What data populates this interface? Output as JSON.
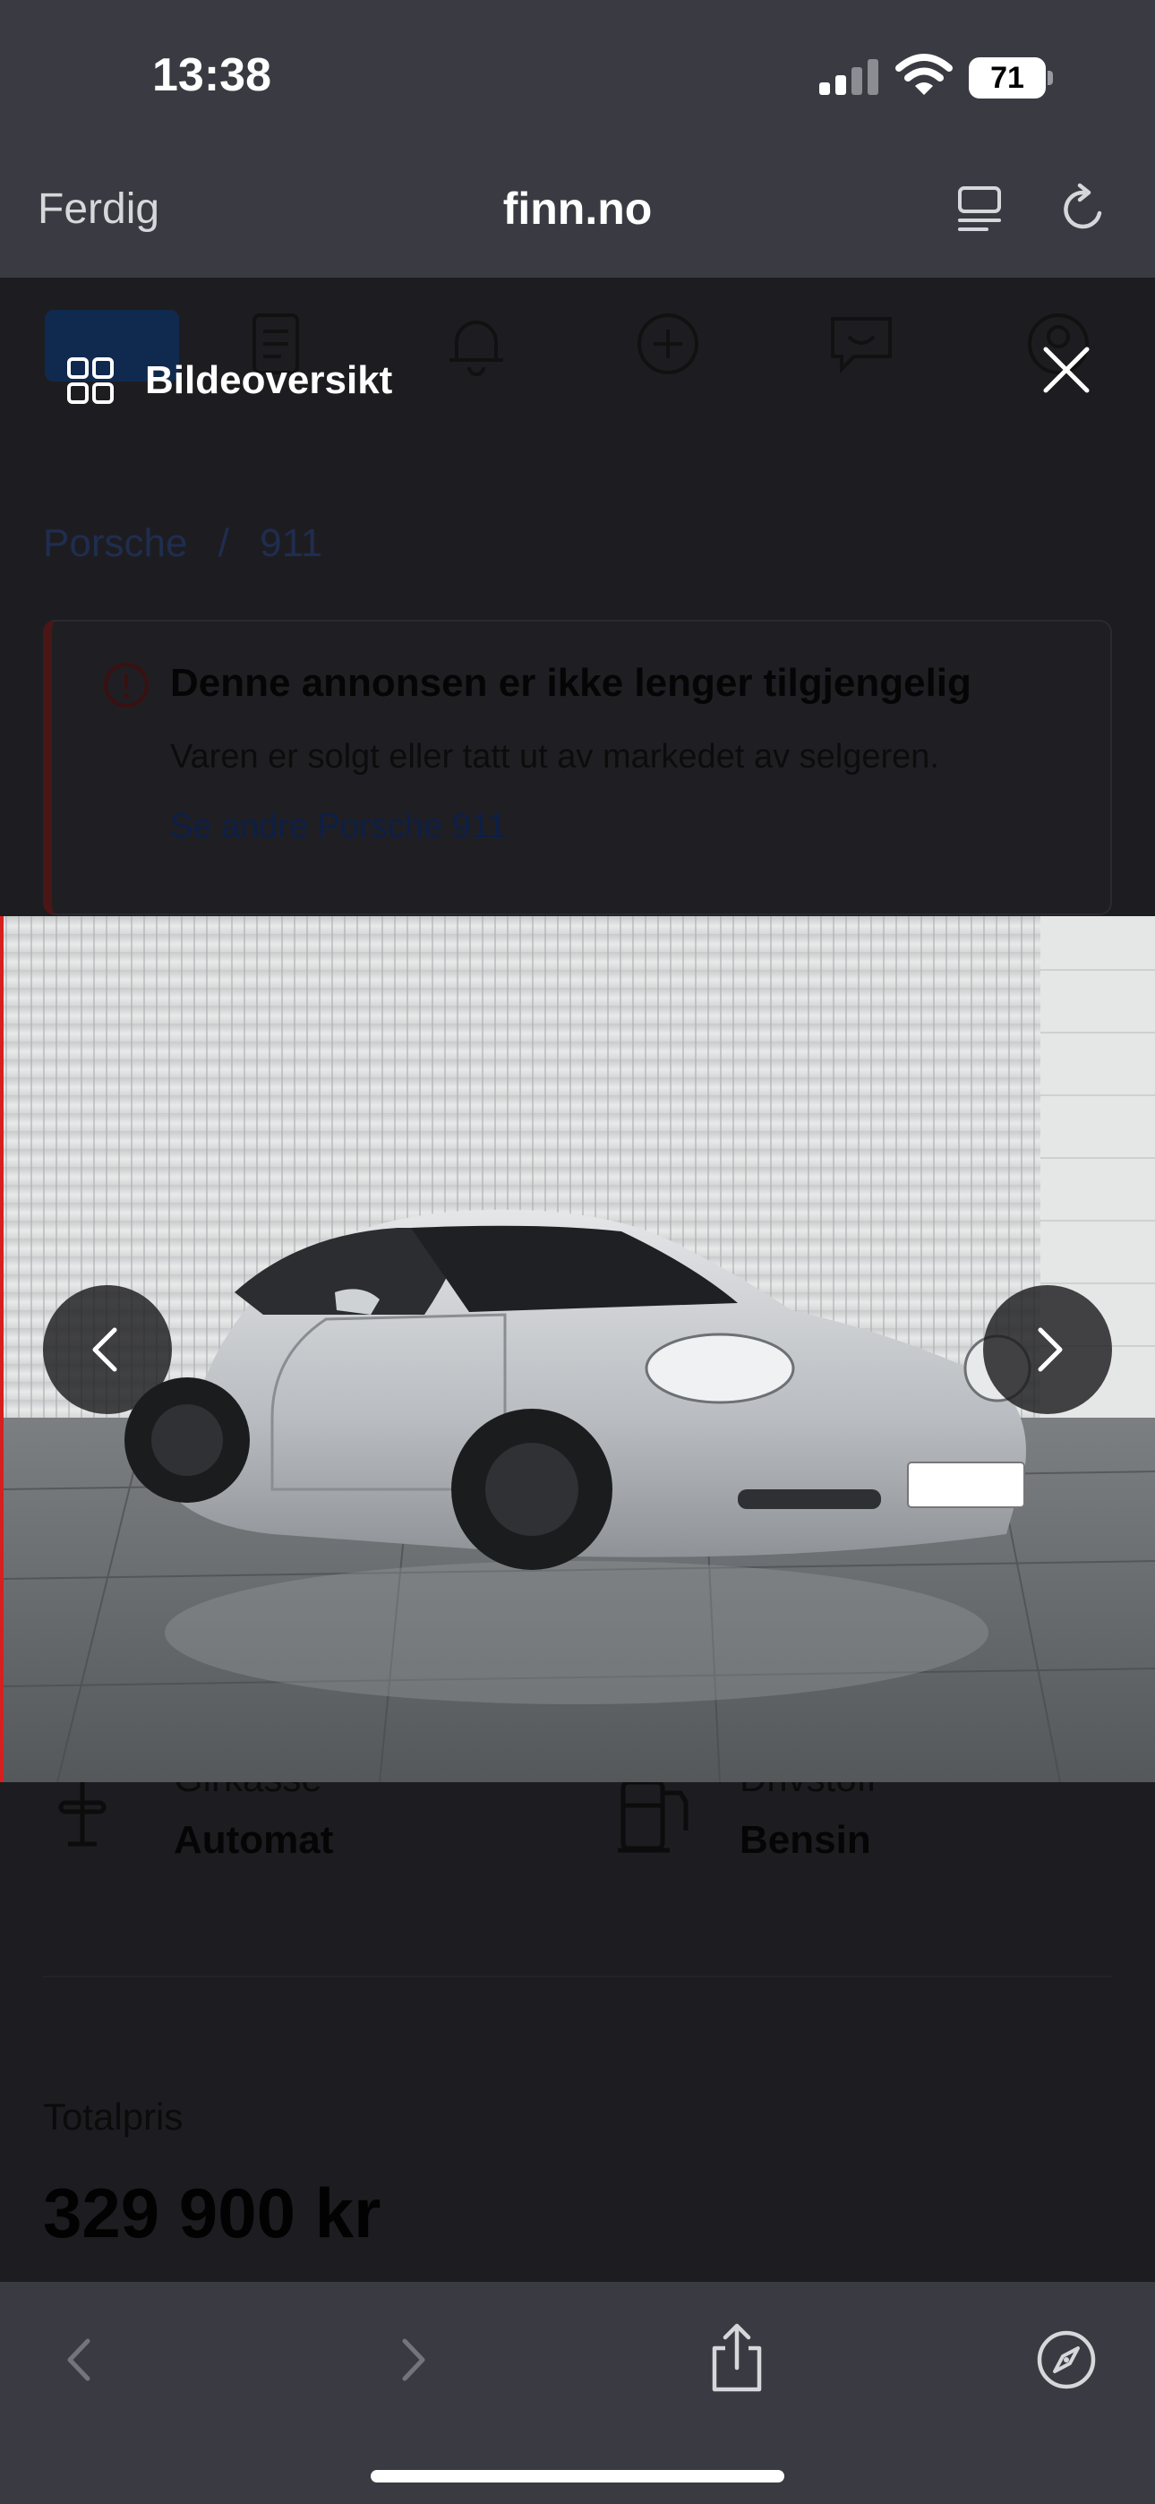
{
  "status_bar": {
    "time": "13:38",
    "battery": "71"
  },
  "safari": {
    "done_label": "Ferdig",
    "domain": "finn.no"
  },
  "gallery": {
    "overview_label": "Bildeoversikt"
  },
  "page": {
    "breadcrumb": [
      "Porsche",
      "/",
      "911"
    ],
    "notice": {
      "title": "Denne annonsen er ikke lenger tilgjengelig",
      "text": "Varen er solgt eller tatt ut av markedet av selgeren.",
      "link": "Se andre Porsche 911"
    },
    "specs": [
      {
        "label": "Girkasse",
        "value": "Automat"
      },
      {
        "label": "Drivstoff",
        "value": "Bensin"
      }
    ],
    "total_label": "Totalpris",
    "total_price": "329 900 kr"
  }
}
